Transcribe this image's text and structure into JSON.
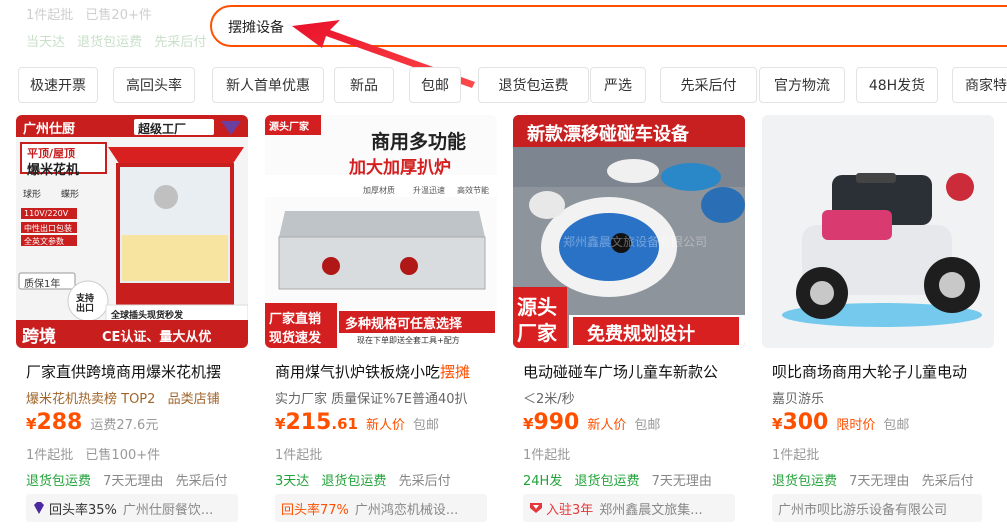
{
  "background_rows": {
    "row1": [
      "1件起批",
      "已售20+件"
    ],
    "row2": [
      "当天达",
      "退货包运费",
      "先采后付"
    ]
  },
  "search": {
    "query": "摆摊设备"
  },
  "filters": [
    "极速开票",
    "高回头率",
    "新人首单优惠",
    "新品",
    "包邮",
    "退货包运费",
    "严选",
    "先采后付",
    "官方物流",
    "48H发货",
    "商家特"
  ],
  "products": [
    {
      "image": {
        "brand": "广州仕厨",
        "badge": "超级工厂",
        "line1": "平顶/屋顶",
        "line2": "爆米花机",
        "opt1": "球形",
        "opt2": "蝶形",
        "voltage": "110V/220V",
        "tag1": "中性出口包装",
        "tag2": "全英文参数",
        "warranty": "质保1年",
        "export": "支持出口",
        "plug": "全球插头现货秒发",
        "big": "跨境",
        "cert": "CE认证、量大从优"
      },
      "title": "厂家直供跨境商用爆米花机摆",
      "title_hl": "",
      "sub_a": "爆米花机热卖榜 TOP2",
      "sub_b": "品类店铺",
      "price_int": "288",
      "price_dec": "",
      "price_extra": "运费27.6元",
      "price_tag": "",
      "moq": "1件起批",
      "sold": "已售100+件",
      "services": [
        "退货包运费",
        "7天无理由",
        "先采后付"
      ],
      "shop_stat": "回头率35%",
      "shop_name": "广州仕厨餐饮..."
    },
    {
      "image": {
        "corner": "源头厂家",
        "h1": "商用多功能",
        "h2": "加大加厚扒炉",
        "f1": "加厚材质",
        "f2": "升温迅速",
        "f3": "高效节能",
        "b1": "厂家直销",
        "b2": "现货速发",
        "b3": "多种规格可任意选择",
        "b4": "现在下单即送全套工具+配方"
      },
      "title": "商用煤气扒炉铁板烧小吃",
      "title_hl": "摆摊",
      "sub_a": "实力厂家 质量保证%7E普通40扒",
      "sub_b": "",
      "price_int": "215",
      "price_dec": ".61",
      "price_extra": "",
      "price_tag": "新人价",
      "price_tag2": "包邮",
      "moq": "1件起批",
      "sold": "",
      "services": [
        "3天达",
        "退货包运费",
        "先采后付"
      ],
      "shop_stat": "回头率77%",
      "shop_name": "广州鸿恋机械设..."
    },
    {
      "image": {
        "h1": "新款漂移碰碰车设备",
        "b1": "源头",
        "b2": "厂家",
        "b3": "免费规划设计",
        "watermark": "郑州鑫晨文旅设备有限公司"
      },
      "title": "电动碰碰车广场儿童车新款公",
      "title_hl": "",
      "sub_a": "＜2米/秒",
      "sub_b": "",
      "price_int": "990",
      "price_dec": "",
      "price_extra": "",
      "price_tag": "新人价",
      "price_tag2": "包邮",
      "moq": "1件起批",
      "sold": "",
      "services": [
        "24H发",
        "退货包运费",
        "7天无理由"
      ],
      "shop_stat": "入驻3年",
      "shop_name": "郑州鑫晨文旅集..."
    },
    {
      "title": "呗比商场商用大轮子儿童电动",
      "title_hl": "",
      "sub_a": "嘉贝游乐",
      "sub_b": "",
      "price_int": "300",
      "price_dec": "",
      "price_extra": "",
      "price_tag": "限时价",
      "price_tag2": "包邮",
      "moq": "1件起批",
      "sold": "",
      "services": [
        "退货包运费",
        "7天无理由",
        "先采后付"
      ],
      "shop_stat": "",
      "shop_name": "广州市呗比游乐设备有限公司"
    }
  ],
  "currency_symbol": "¥",
  "colors": {
    "accent": "#ff5000",
    "service_green": "#22a33a",
    "gold_text": "#a0652b",
    "chip_border": "#e3e3e3"
  }
}
